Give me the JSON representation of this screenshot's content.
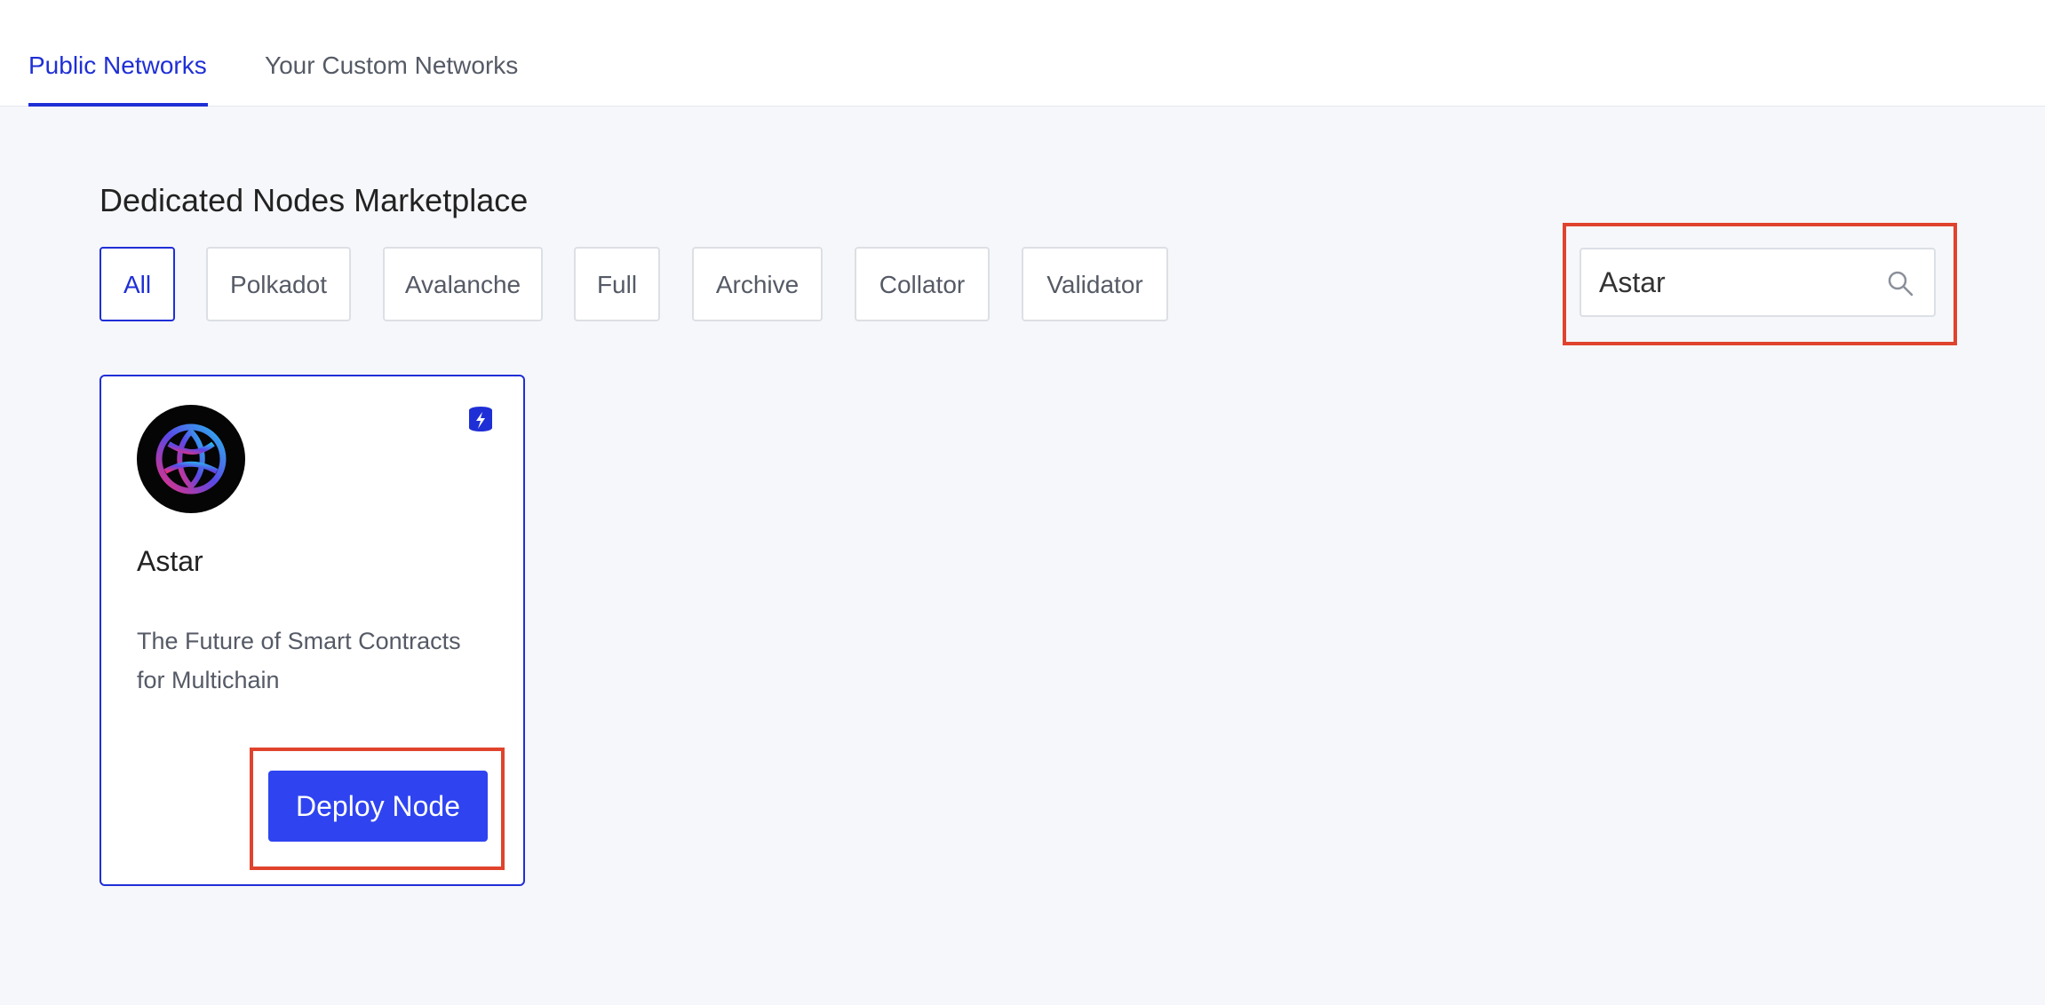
{
  "tabs": {
    "public": "Public Networks",
    "custom": "Your Custom Networks"
  },
  "page_title": "Dedicated Nodes Marketplace",
  "filters": [
    "All",
    "Polkadot",
    "Avalanche",
    "Full",
    "Archive",
    "Collator",
    "Validator"
  ],
  "search": {
    "value": "Astar",
    "icon": "search-icon"
  },
  "card": {
    "name": "Astar",
    "description": "The Future of Smart Contracts for Multichain",
    "badge_icon": "lightning-database-icon",
    "button_label": "Deploy Node"
  },
  "colors": {
    "accent": "#1f2fd6",
    "button": "#2f44f0",
    "highlight": "#e0432d"
  }
}
